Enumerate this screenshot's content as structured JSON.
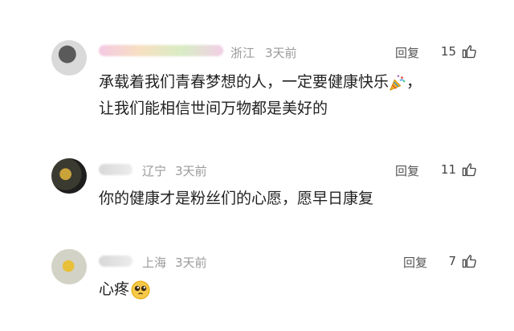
{
  "comments": [
    {
      "nickname": "",
      "location": "浙江",
      "time": "3天前",
      "reply_label": "回复",
      "likes": "15",
      "lines": [
        "承载着我们青春梦想的人，一定要健康快乐",
        "，",
        "让我们能相信世间万物都是美好的"
      ],
      "emoji": "party-popper"
    },
    {
      "nickname": "",
      "location": "辽宁",
      "time": "3天前",
      "reply_label": "回复",
      "likes": "11",
      "lines": [
        "你的健康才是粉丝们的心愿，愿早日康复"
      ]
    },
    {
      "nickname": "",
      "location": "上海",
      "time": "3天前",
      "reply_label": "回复",
      "likes": "7",
      "lines": [
        "心疼"
      ],
      "emoji": "pleading-face"
    }
  ],
  "colors": {
    "text": "#222222",
    "meta": "#9a9a9a",
    "background": "#ffffff"
  }
}
